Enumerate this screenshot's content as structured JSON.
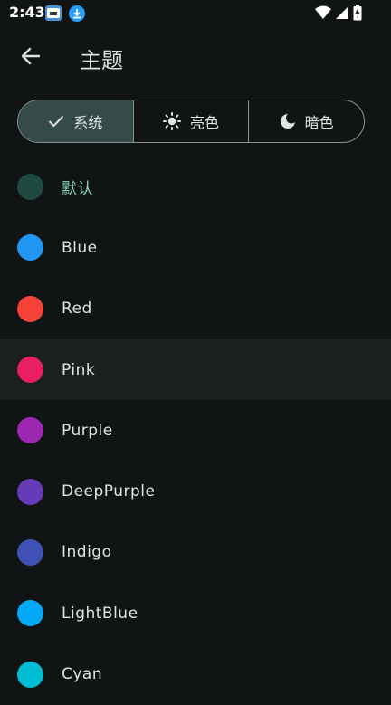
{
  "status": {
    "time": "2:43"
  },
  "header": {
    "title": "主题"
  },
  "mode_selector": {
    "options": [
      {
        "label": "系统",
        "icon": "check-icon",
        "selected": true
      },
      {
        "label": "亮色",
        "icon": "sun-icon",
        "selected": false
      },
      {
        "label": "暗色",
        "icon": "moon-icon",
        "selected": false
      }
    ]
  },
  "themes": [
    {
      "label": "默认",
      "color": "#1f4a40",
      "active": true
    },
    {
      "label": "Blue",
      "color": "#2196f3"
    },
    {
      "label": "Red",
      "color": "#f44336"
    },
    {
      "label": "Pink",
      "color": "#e91e63"
    },
    {
      "label": "Purple",
      "color": "#9c27b0"
    },
    {
      "label": "DeepPurple",
      "color": "#673ab7"
    },
    {
      "label": "Indigo",
      "color": "#3f51b5"
    },
    {
      "label": "LightBlue",
      "color": "#03a9f4"
    },
    {
      "label": "Cyan",
      "color": "#00bcd4"
    }
  ]
}
